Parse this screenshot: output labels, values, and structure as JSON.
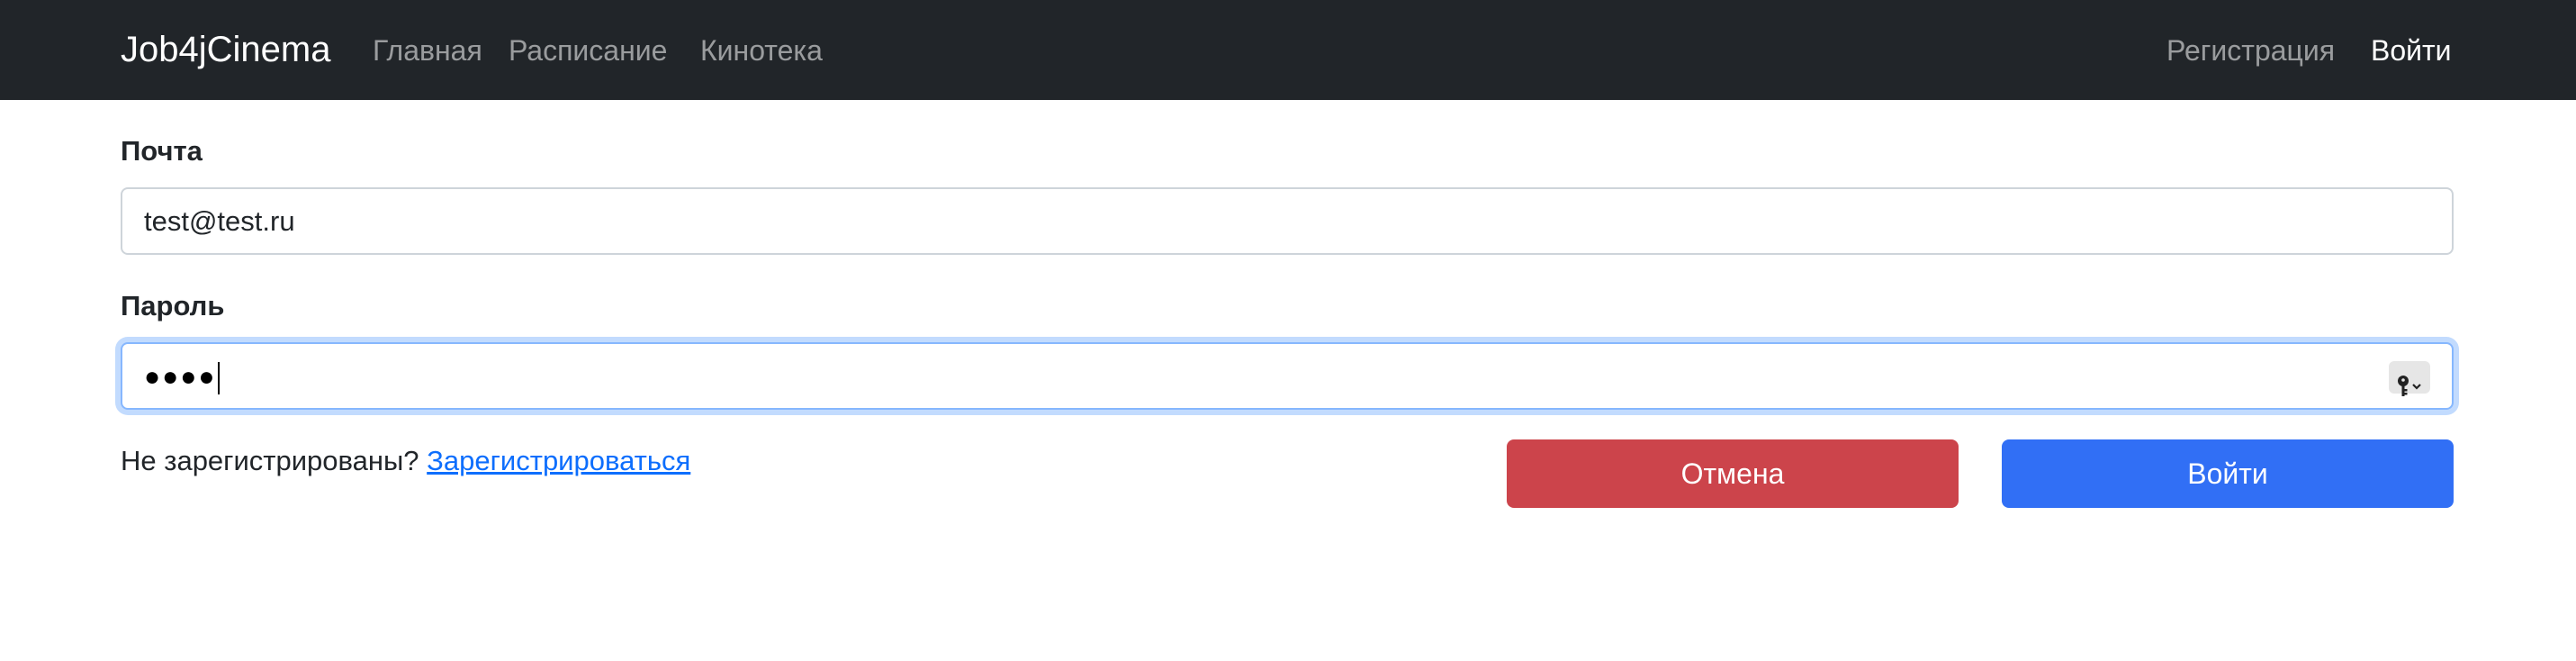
{
  "navbar": {
    "brand": "Job4jCinema",
    "links": [
      "Главная",
      "Расписание",
      "Кинотека"
    ],
    "register": "Регистрация",
    "login": "Войти"
  },
  "form": {
    "email_label": "Почта",
    "email_value": "test@test.ru",
    "password_label": "Пароль",
    "password_masked": "●●●●",
    "password_icon": "key-icon"
  },
  "footer": {
    "question": "Не зарегистрированы?",
    "register_link": "Зарегистрироваться"
  },
  "buttons": {
    "cancel": "Отмена",
    "login": "Войти"
  },
  "colors": {
    "navbar_bg": "#212529",
    "cancel": "#cc444b",
    "primary": "#316ff5",
    "link": "#0d6efd"
  }
}
